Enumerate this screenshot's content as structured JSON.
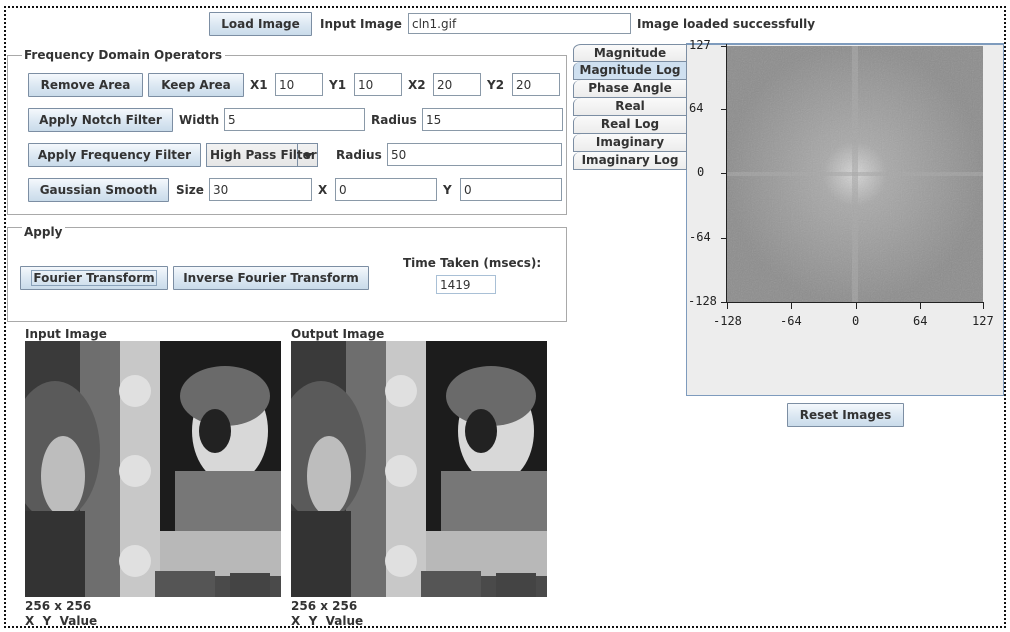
{
  "toolbar": {
    "load_button": "Load Image",
    "input_label": "Input Image",
    "file_value": "cln1.gif",
    "status": "Image loaded successfully"
  },
  "freq_ops": {
    "title": "Frequency Domain Operators",
    "remove_area": "Remove Area",
    "keep_area": "Keep Area",
    "x1_label": "X1",
    "x1_value": "10",
    "y1_label": "Y1",
    "y1_value": "10",
    "x2_label": "X2",
    "x2_value": "20",
    "y2_label": "Y2",
    "y2_value": "20",
    "notch_button": "Apply Notch Filter",
    "width_label": "Width",
    "width_value": "5",
    "notch_radius_label": "Radius",
    "notch_radius_value": "15",
    "freq_button": "Apply Frequency Filter",
    "filter_type": "High Pass Filter",
    "freq_radius_label": "Radius",
    "freq_radius_value": "50",
    "gauss_button": "Gaussian Smooth",
    "size_label": "Size",
    "size_value": "30",
    "x_label": "X",
    "x_value": "0",
    "y_label": "Y",
    "y_value": "0"
  },
  "apply": {
    "title": "Apply",
    "fourier_button": "Fourier Transform",
    "inverse_button": "Inverse Fourier Transform",
    "time_label": "Time Taken (msecs):",
    "time_value": "1419"
  },
  "images": {
    "input": {
      "title": "Input Image",
      "size": "256 x 256",
      "readout": "X  Y  Value"
    },
    "output": {
      "title": "Output Image",
      "size": "256 x 256",
      "readout": "X  Y  Value"
    }
  },
  "spectrum_tabs": [
    {
      "label": "Magnitude",
      "active": false
    },
    {
      "label": "Magnitude Log",
      "active": true
    },
    {
      "label": "Phase Angle",
      "active": false
    },
    {
      "label": "Real",
      "active": false
    },
    {
      "label": "Real Log",
      "active": false
    },
    {
      "label": "Imaginary",
      "active": false
    },
    {
      "label": "Imaginary Log",
      "active": false
    }
  ],
  "spectrum": {
    "y_ticks": [
      "127",
      "64",
      "0",
      "-64",
      "-128"
    ],
    "x_ticks": [
      "-128",
      "-64",
      "0",
      "64",
      "127"
    ],
    "x_range": [
      -128,
      127
    ],
    "y_range": [
      -128,
      127
    ]
  },
  "reset_button": "Reset Images"
}
